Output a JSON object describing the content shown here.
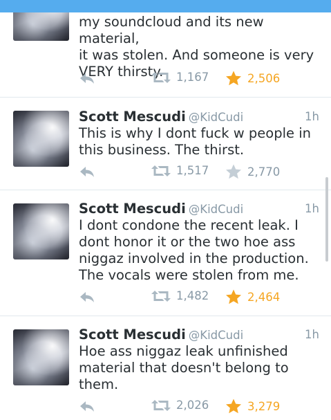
{
  "status_bar_color": "#55acee",
  "colors": {
    "favorite_active": "#f5a623",
    "muted": "#8899a6",
    "text": "#292f33"
  },
  "tweets": [
    {
      "name": "",
      "handle": "",
      "time": "",
      "text": "my soundcloud and its new material,\nit was stolen.  And someone is very\nVERY thirsty.",
      "retweets": "1,167",
      "favorites": "2,506",
      "favorited": true
    },
    {
      "name": "Scott Mescudi",
      "handle": "@KidCudi",
      "time": "1h",
      "text": "This is why I dont fuck w people in\nthis business.  The thirst.",
      "retweets": "1,517",
      "favorites": "2,770",
      "favorited": false
    },
    {
      "name": "Scott Mescudi",
      "handle": "@KidCudi",
      "time": "1h",
      "text": "I dont condone the recent leak. I\ndont honor it or the two hoe ass\nniggaz involved in the production.\nThe vocals were stolen from me.",
      "retweets": "1,482",
      "favorites": "2,464",
      "favorited": true
    },
    {
      "name": "Scott Mescudi",
      "handle": "@KidCudi",
      "time": "1h",
      "text": "Hoe ass niggaz leak unfinished\nmaterial that doesn't belong to\nthem.",
      "retweets": "2,026",
      "favorites": "3,279",
      "favorited": true
    }
  ]
}
